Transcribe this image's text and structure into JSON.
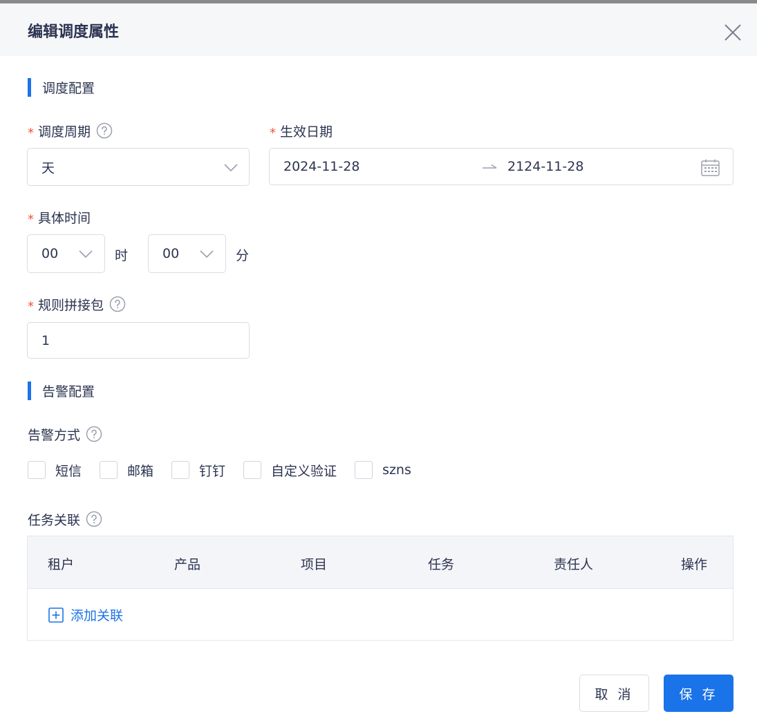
{
  "dialog": {
    "title": "编辑调度属性"
  },
  "schedule_section": {
    "title": "调度配置",
    "period": {
      "label": "调度周期",
      "value": "天"
    },
    "effective_date": {
      "label": "生效日期",
      "start": "2024-11-28",
      "end": "2124-11-28"
    },
    "time": {
      "label": "具体时间",
      "hour": "00",
      "hour_unit": "时",
      "minute": "00",
      "minute_unit": "分"
    },
    "rule_package": {
      "label": "规则拼接包",
      "value": "1"
    }
  },
  "alert_section": {
    "title": "告警配置",
    "method_label": "告警方式",
    "methods": [
      {
        "label": "短信",
        "checked": false
      },
      {
        "label": "邮箱",
        "checked": false
      },
      {
        "label": "钉钉",
        "checked": false
      },
      {
        "label": "自定义验证",
        "checked": false
      },
      {
        "label": "szns",
        "checked": false
      }
    ]
  },
  "task_link": {
    "label": "任务关联",
    "columns": [
      "租户",
      "产品",
      "项目",
      "任务",
      "责任人",
      "操作"
    ],
    "add_label": "添加关联"
  },
  "footer": {
    "cancel": "取 消",
    "save": "保 存"
  },
  "colors": {
    "primary": "#1a73e8",
    "required": "#f0533c",
    "text": "#2b3350"
  }
}
